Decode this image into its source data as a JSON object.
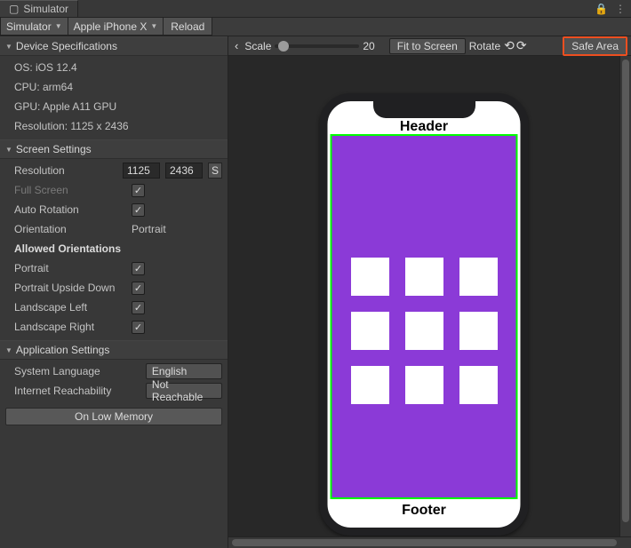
{
  "window": {
    "tab_title": "Simulator"
  },
  "toolbar": {
    "mode": "Simulator",
    "device": "Apple iPhone X",
    "reload_label": "Reload"
  },
  "device_specs": {
    "title": "Device Specifications",
    "os": "OS: iOS 12.4",
    "cpu": "CPU: arm64",
    "gpu": "GPU: Apple A11 GPU",
    "resolution": "Resolution: 1125 x 2436"
  },
  "screen_settings": {
    "title": "Screen Settings",
    "resolution_label": "Resolution",
    "resolution_w": "1125",
    "resolution_h": "2436",
    "resolution_suffix": "S",
    "full_screen_label": "Full Screen",
    "auto_rotation_label": "Auto Rotation",
    "orientation_label": "Orientation",
    "orientation_value": "Portrait",
    "allowed_orientations_label": "Allowed Orientations",
    "portrait_label": "Portrait",
    "portrait_upside_down_label": "Portrait Upside Down",
    "landscape_left_label": "Landscape Left",
    "landscape_right_label": "Landscape Right"
  },
  "application_settings": {
    "title": "Application Settings",
    "system_language_label": "System Language",
    "system_language_value": "English",
    "internet_reachability_label": "Internet Reachability",
    "internet_reachability_value": "Not Reachable",
    "on_low_memory_label": "On Low Memory"
  },
  "preview_toolbar": {
    "scale_label": "Scale",
    "scale_value": "20",
    "fit_to_screen_label": "Fit to Screen",
    "rotate_label": "Rotate",
    "safe_area_label": "Safe Area"
  },
  "phone": {
    "header": "Header",
    "footer": "Footer"
  }
}
